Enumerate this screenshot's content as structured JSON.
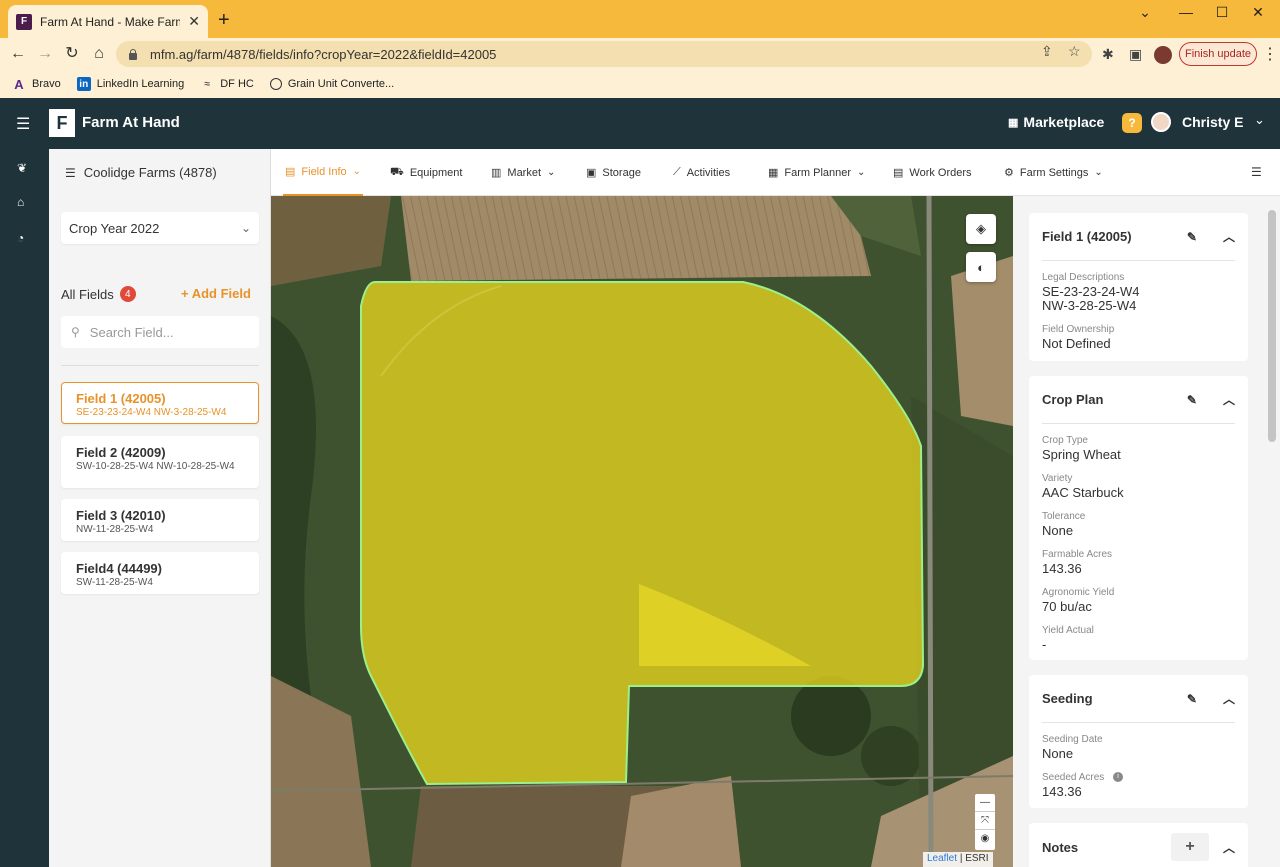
{
  "browser": {
    "tab_title": "Farm At Hand - Make Farm Man",
    "url": "mfm.ag/farm/4878/fields/info?cropYear=2022&fieldId=42005",
    "finish_update": "Finish update",
    "bookmarks": [
      {
        "label": "Bravo"
      },
      {
        "label": "LinkedIn Learning"
      },
      {
        "label": "DF HC"
      },
      {
        "label": "Grain Unit Converte..."
      }
    ]
  },
  "header": {
    "brand": "Farm At Hand",
    "marketplace": "Marketplace",
    "user_name": "Christy E"
  },
  "fields_panel": {
    "farm_title": "Coolidge Farms (4878)",
    "crop_year": "Crop Year 2022",
    "all_fields_label": "All Fields",
    "field_count": "4",
    "add_field": "+ Add Field",
    "search_placeholder": "Search Field...",
    "fields": [
      {
        "name": "Field 1 (42005)",
        "desc": "SE-23-23-24-W4 NW-3-28-25-W4"
      },
      {
        "name": "Field 2 (42009)",
        "desc": "SW-10-28-25-W4 NW-10-28-25-W4"
      },
      {
        "name": "Field 3 (42010)",
        "desc": "NW-11-28-25-W4"
      },
      {
        "name": "Field4 (44499)",
        "desc": "SW-11-28-25-W4"
      }
    ]
  },
  "nav": {
    "items": [
      {
        "label": "Field Info"
      },
      {
        "label": "Equipment"
      },
      {
        "label": "Market"
      },
      {
        "label": "Storage"
      },
      {
        "label": "Activities"
      },
      {
        "label": "Farm Planner"
      },
      {
        "label": "Work Orders"
      },
      {
        "label": "Farm Settings"
      }
    ]
  },
  "map": {
    "attribution_leaflet": "Leaflet",
    "attribution_esri": "ESRI",
    "field_color": "#e6d51f"
  },
  "info": {
    "field_card": {
      "title": "Field 1 (42005)",
      "legal_label": "Legal Descriptions",
      "legal_1": "SE-23-23-24-W4",
      "legal_2": "NW-3-28-25-W4",
      "ownership_label": "Field Ownership",
      "ownership_value": "Not Defined"
    },
    "crop_plan": {
      "title": "Crop Plan",
      "crop_type_label": "Crop Type",
      "crop_type": "Spring Wheat",
      "variety_label": "Variety",
      "variety": "AAC Starbuck",
      "tolerance_label": "Tolerance",
      "tolerance": "None",
      "farmable_label": "Farmable Acres",
      "farmable": "143.36",
      "yield_label": "Agronomic Yield",
      "yield": "70 bu/ac",
      "yield_actual_label": "Yield Actual",
      "yield_actual": "-"
    },
    "seeding": {
      "title": "Seeding",
      "date_label": "Seeding Date",
      "date": "None",
      "acres_label": "Seeded Acres",
      "acres": "143.36"
    },
    "notes": {
      "title": "Notes"
    }
  },
  "colors": {
    "accent": "#e8922a",
    "header_bg": "#1f333b",
    "chrome_bg": "#f6b93b"
  }
}
